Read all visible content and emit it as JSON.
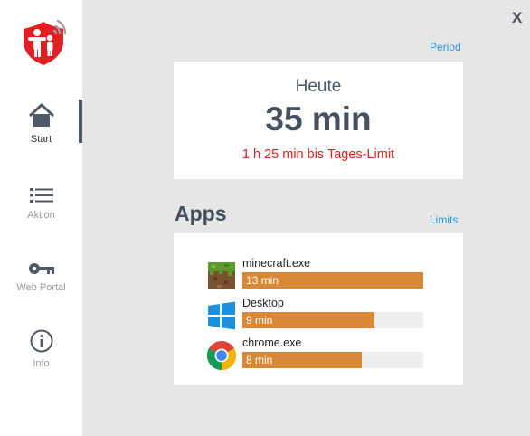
{
  "nav": {
    "items": [
      {
        "label": "Start",
        "icon": "home-icon"
      },
      {
        "label": "Aktion",
        "icon": "list-icon"
      },
      {
        "label": "Web Portal",
        "icon": "key-icon"
      },
      {
        "label": "Info",
        "icon": "info-icon"
      }
    ],
    "active": "Start"
  },
  "header": {
    "close_label": "X",
    "period_label": "Period"
  },
  "today": {
    "title": "Heute",
    "value": "35 min",
    "remaining": "1 h 25 min bis Tages-Limit"
  },
  "apps": {
    "heading": "Apps",
    "limits_label": "Limits",
    "items": [
      {
        "name": "minecraft.exe",
        "time": "13 min",
        "usage_fraction": 1.0,
        "icon": "minecraft-icon"
      },
      {
        "name": "Desktop",
        "time": "9 min",
        "usage_fraction": 0.73,
        "icon": "windows-icon"
      },
      {
        "name": "chrome.exe",
        "time": "8 min",
        "usage_fraction": 0.66,
        "icon": "chrome-icon"
      }
    ]
  },
  "colors": {
    "accent_link": "#2a9ad8",
    "bar_fill": "#d98837",
    "limit_text": "#e0201e",
    "brand_red": "#e01e24"
  }
}
